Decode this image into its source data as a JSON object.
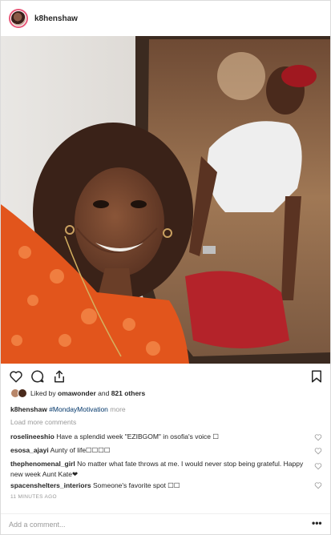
{
  "post": {
    "username": "k8henshaw",
    "photo_alt": "",
    "likes": {
      "prefix": "Liked by",
      "user": "omawonder",
      "and": "and",
      "others": "821 others"
    },
    "caption": {
      "user": "k8henshaw",
      "hashtag": "#MondayMotivation",
      "more": "more"
    },
    "load_more": "Load more comments",
    "comments": [
      {
        "user": "roselineeshio",
        "text": "Have a splendid week \"EZIBGOM\" in osofia's voice ☐"
      },
      {
        "user": "esosa_ajayi",
        "text": "Aunty of life☐☐☐☐"
      },
      {
        "user": "thephenomenal_girl",
        "text": "No matter what fate throws at me. I would never stop being grateful. Happy new week Aunt Kate❤"
      },
      {
        "user": "spacenshelters_interiors",
        "text": "Someone's favorite spot ☐☐"
      }
    ],
    "timestamp": "11 MINUTES AGO",
    "add_comment_placeholder": "Add a comment...",
    "more_options": "•••"
  },
  "icons": {
    "like": "heart-icon",
    "comment": "comment-icon",
    "share": "share-icon",
    "save": "bookmark-icon"
  },
  "colors": {
    "hashtag": "#003569",
    "muted": "#999999",
    "text": "#262626",
    "story_ring": "#e85a7a"
  }
}
